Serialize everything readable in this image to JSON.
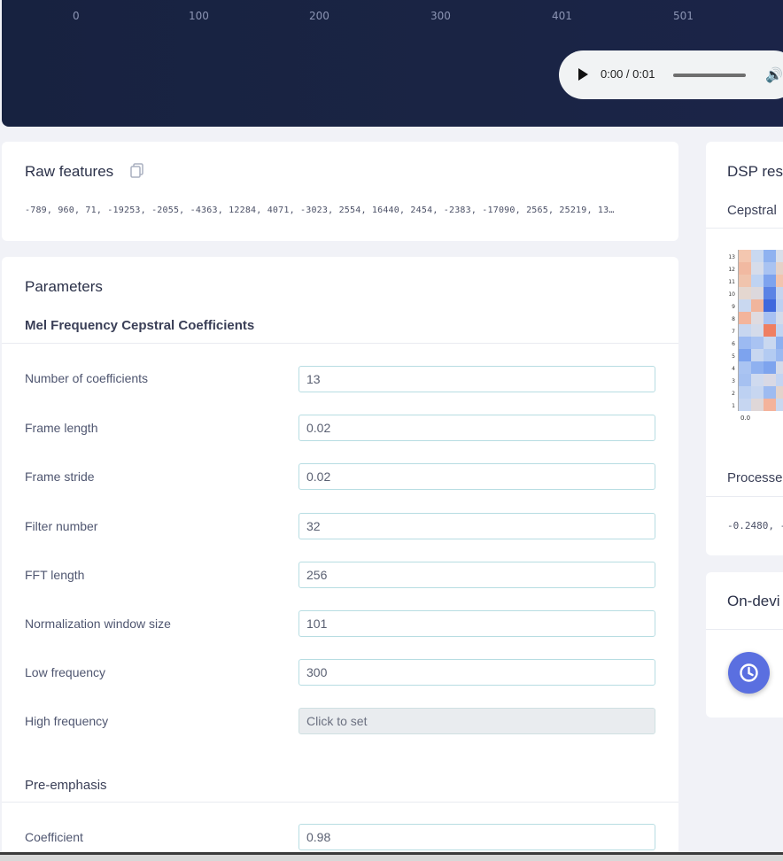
{
  "header": {
    "ticks": [
      "0",
      "100",
      "200",
      "300",
      "401",
      "501"
    ],
    "audio": {
      "time": "0:00 / 0:01"
    }
  },
  "raw_features": {
    "title": "Raw features",
    "values": "-789, 960, 71, -19253, -2055, -4363, 12284, 4071, -3023, 2554, 16440, 2454, -2383, -17090, 2565, 25219, 13…"
  },
  "parameters": {
    "title": "Parameters",
    "mfcc_title": "Mel Frequency Cepstral Coefficients",
    "fields": [
      {
        "label": "Number of coefficients",
        "value": "13"
      },
      {
        "label": "Frame length",
        "value": "0.02"
      },
      {
        "label": "Frame stride",
        "value": "0.02"
      },
      {
        "label": "Filter number",
        "value": "32"
      },
      {
        "label": "FFT length",
        "value": "256"
      },
      {
        "label": "Normalization window size",
        "value": "101"
      },
      {
        "label": "Low frequency",
        "value": "300"
      },
      {
        "label": "High frequency",
        "value": "",
        "placeholder": "Click to set"
      }
    ],
    "pre_emphasis_title": "Pre-emphasis",
    "coefficient": {
      "label": "Coefficient",
      "value": "0.98"
    }
  },
  "dsp_result": {
    "title": "DSP res",
    "cepstral_title": "Cepstral",
    "y_ticks": [
      "13",
      "12",
      "11",
      "10",
      "9",
      "8",
      "7",
      "6",
      "5",
      "4",
      "3",
      "2",
      "1"
    ],
    "x_tick": "0.0",
    "heatmap_colors": [
      [
        "#f4c7b0",
        "#c9d8f0",
        "#8fb2f0",
        "#d9dfea"
      ],
      [
        "#f1b9a1",
        "#d6dcea",
        "#a9c3f2",
        "#e5d2c8"
      ],
      [
        "#f0c4ad",
        "#bfd3f2",
        "#7ea3ee",
        "#f2c4ae"
      ],
      [
        "#e4d7d0",
        "#dcd8dc",
        "#5b83e5",
        "#c5d4ef"
      ],
      [
        "#c9d8f0",
        "#f1b59c",
        "#3f68dd",
        "#bcd0f2"
      ],
      [
        "#f3b49b",
        "#dfdbe0",
        "#a8c1f2",
        "#d3dbea"
      ],
      [
        "#c7d6f0",
        "#d4dbea",
        "#ef7f62",
        "#c1d4f2"
      ],
      [
        "#9cbaf2",
        "#a9c3f2",
        "#c9d8f0",
        "#8cb0f0"
      ],
      [
        "#7da3ee",
        "#c8d7f0",
        "#b3cbf2",
        "#9ab9f1"
      ],
      [
        "#aac4f2",
        "#8fb1f0",
        "#7ea4ee",
        "#d4dbea"
      ],
      [
        "#a6c1f1",
        "#cfdaef",
        "#d9d9e5",
        "#c3d4f2"
      ],
      [
        "#bdd1f2",
        "#c7d6f0",
        "#9ebbf1",
        "#e3d3cc"
      ],
      [
        "#c6d6f1",
        "#dfd7d8",
        "#f4b39b",
        "#c9d8f0"
      ]
    ],
    "processed_title": "Processe",
    "processed_value": "-0.2480, -"
  },
  "on_device": {
    "title": "On-devi"
  }
}
